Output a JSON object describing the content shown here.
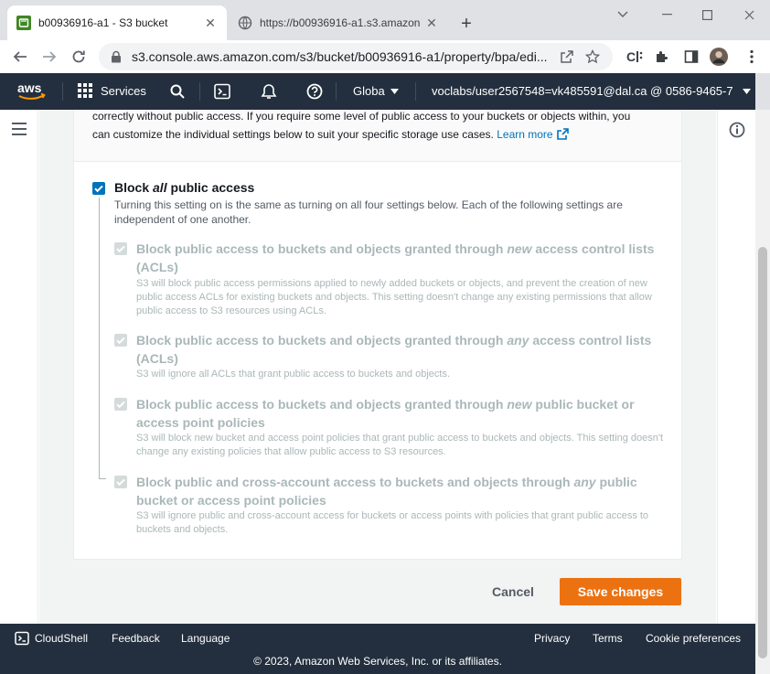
{
  "browser": {
    "tabs": [
      {
        "title": "b00936916-a1 - S3 bucket",
        "active": true
      },
      {
        "title": "https://b00936916-a1.s3.amazon",
        "active": false
      }
    ],
    "url": "s3.console.aws.amazon.com/s3/bucket/b00936916-a1/property/bpa/edi..."
  },
  "aws_nav": {
    "services_label": "Services",
    "region_label": "Globa",
    "account_label": "voclabs/user2567548=vk485591@dal.ca @ 0586-9465-7"
  },
  "intro": {
    "line1": "correctly without public access. If you require some level of public access to your buckets or objects within, you",
    "line2": "can customize the individual settings below to suit your specific storage use cases.",
    "learn_more": "Learn more"
  },
  "master": {
    "title_pre": "Block ",
    "title_em": "all",
    "title_post": " public access",
    "checked": true,
    "desc": "Turning this setting on is the same as turning on all four settings below. Each of the following settings are independent of one another."
  },
  "options": [
    {
      "title_pre": "Block public access to buckets and objects granted through ",
      "title_em": "new",
      "title_post": " access control lists (ACLs)",
      "desc": "S3 will block public access permissions applied to newly added buckets or objects, and prevent the creation of new public access ACLs for existing buckets and objects. This setting doesn't change any existing permissions that allow public access to S3 resources using ACLs.",
      "checked": true
    },
    {
      "title_pre": "Block public access to buckets and objects granted through ",
      "title_em": "any",
      "title_post": " access control lists (ACLs)",
      "desc": "S3 will ignore all ACLs that grant public access to buckets and objects.",
      "checked": true
    },
    {
      "title_pre": "Block public access to buckets and objects granted through ",
      "title_em": "new",
      "title_post": " public bucket or access point policies",
      "desc": "S3 will block new bucket and access point policies that grant public access to buckets and objects. This setting doesn't change any existing policies that allow public access to S3 resources.",
      "checked": true
    },
    {
      "title_pre": "Block public and cross-account access to buckets and objects through ",
      "title_em": "any",
      "title_post": " public bucket or access point policies",
      "desc": "S3 will ignore public and cross-account access for buckets or access points with policies that grant public access to buckets and objects.",
      "checked": true
    }
  ],
  "actions": {
    "cancel": "Cancel",
    "save": "Save changes"
  },
  "footer": {
    "cloudshell": "CloudShell",
    "feedback": "Feedback",
    "language": "Language",
    "privacy": "Privacy",
    "terms": "Terms",
    "cookie": "Cookie preferences",
    "copyright": "© 2023, Amazon Web Services, Inc. or its affiliates."
  },
  "colors": {
    "aws_nav_bg": "#232f3e",
    "primary_button": "#ec7211",
    "link": "#0073bb",
    "disabled_text": "#aab7b8"
  }
}
